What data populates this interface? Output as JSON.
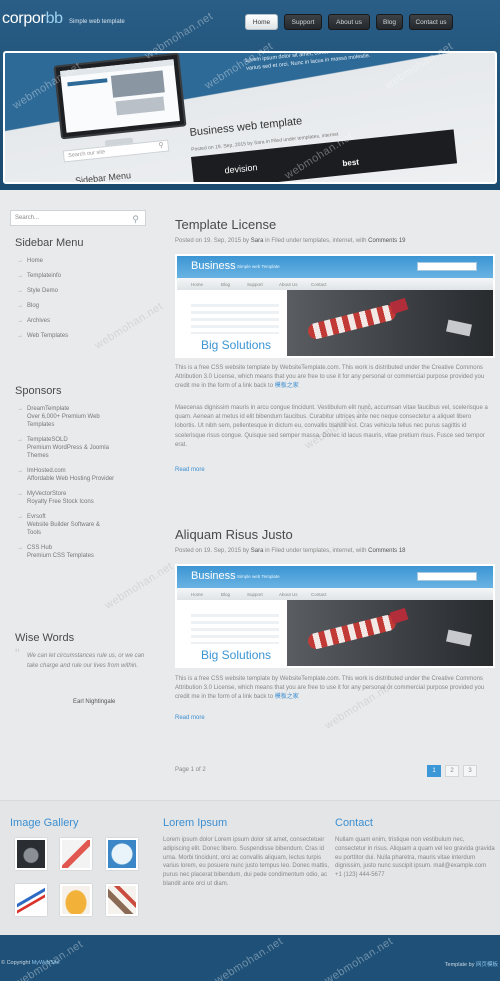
{
  "header": {
    "logo_a": "corpor",
    "logo_b": "bb",
    "tagline": "Simple web template",
    "nav": [
      "Home",
      "Support",
      "About us",
      "Blog",
      "Contact us"
    ],
    "active_nav": "Home"
  },
  "slider": {
    "text": "Lorem ipsum dolor sit amet, consectetur adipiscing elit simple aliquam et adipiscing tincidunt auctor varius sed et orci. Nunc in lacus in massa molestie.",
    "search_placeholder": "Search our site",
    "sidebar_label": "Sidebar Menu",
    "heading": "Business web template",
    "meta": "Posted on 19. Sep, 2015 by Sara in Filed under templates, internet",
    "banner_a": "devision",
    "banner_b": "best"
  },
  "sidebar": {
    "search_placeholder": "Search...",
    "menu_title": "Sidebar Menu",
    "menu_items": [
      "Home",
      "Templateinfo",
      "Style Demo",
      "Blog",
      "Archives",
      "Web Templates"
    ],
    "sponsors_title": "Sponsors",
    "sponsors": [
      {
        "name": "DreamTemplate",
        "desc": "Over 6,000+ Premium Web Templates"
      },
      {
        "name": "TemplateSOLD",
        "desc": "Premium WordPress & Joomla Themes"
      },
      {
        "name": "ImHosted.com",
        "desc": "Affordable Web Hosting Provider"
      },
      {
        "name": "MyVectorStore",
        "desc": "Royalty Free Stock Icons"
      },
      {
        "name": "Evrsoft",
        "desc": "Website Builder Software & Tools"
      },
      {
        "name": "CSS Hub",
        "desc": "Premium CSS Templates"
      }
    ],
    "words_title": "Wise Words",
    "quote": "We can let circumstances rule us, or we can take charge and rule our lives from within.",
    "quote_author": "Earl Nightingale"
  },
  "posts": [
    {
      "title": "Template License",
      "meta_prefix": "Posted on 19. Sep, 2015 by ",
      "author": "Sara",
      "meta_mid": " in Filed under templates, internet, with ",
      "comments": "Comments 19",
      "image_brand": "Business",
      "image_tag": "Simple web Template",
      "image_menu": [
        "Home",
        "Blog",
        "Support",
        "About Us",
        "Contact"
      ],
      "image_big": "Big Solutions",
      "body1": "This is a free CSS website template by WebsiteTemplate.com. This work is distributed under the Creative Commons Attribution 3.0 License, which means that you are free to use it for any personal or commercial purpose provided you credit me in the form of a link back to ",
      "body1_link": "模板之家",
      "body2": "Maecenas dignissim mauris in arcu congue tincidunt. Vestibulum elit nunc, accumsan vitae faucibus vel, scelerisque a quam. Aenean at metus id elit bibendum faucibus. Curabitur ultrices ante nec neque consectetur a aliquet libero lobortis. Ut nibh sem, pellentesque in dictum eu, convallis blandit est. Cras vehicula tellus nec purus sagittis id scelerisque risus congue. Quisque sed semper massa. Donec id lacus mauris, vitae pretium risus. Fusce sed tempor erat.",
      "read_more": "Read more"
    },
    {
      "title": "Aliquam Risus Justo",
      "meta_prefix": "Posted on 19. Sep, 2015 by ",
      "author": "Sara",
      "meta_mid": " in Filed under templates, internet, with ",
      "comments": "Comments 18",
      "image_brand": "Business",
      "image_tag": "Simple web Template",
      "image_menu": [
        "Home",
        "Blog",
        "Support",
        "About Us",
        "Contact"
      ],
      "image_big": "Big Solutions",
      "body1": "This is a free CSS website template by WebsiteTemplate.com. This work is distributed under the Creative Commons Attribution 3.0 License, which means that you are free to use it for any personal or commercial purpose provided you credit me in the form of a link back to ",
      "body1_link": "模板之家",
      "read_more": "Read more"
    }
  ],
  "pagination": {
    "label": "Page 1 of 2",
    "pages": [
      "1",
      "2",
      "3"
    ],
    "active": "1"
  },
  "bottom": {
    "gallery_title": "Image Gallery",
    "gallery_icons": [
      "camera-icon",
      "shoes-icon",
      "clock-icon",
      "chart-arrow-icon",
      "idea-icon",
      "tools-icon"
    ],
    "lorem_title": "Lorem Ipsum",
    "lorem_text": "Lorem ipsum dolor Lorem ipsum dolor sit amet, consectetuer adipiscing elit. Donec libero. Suspendisse bibendum. Cras id urna. Morbi tincidunt, orci ac convallis aliquam, lectus turpis varius lorem, eu posuere nunc justo tempus leo. Donec mattis, purus nec placerat bibendum, dui pede condimentum odio, ac blandit ante orci ut diam.",
    "contact_title": "Contact",
    "contact_text": "Nullam quam enim, tristique non vestibulum nec, consectetur in risus. Aliquam a quam vel leo gravida gravida eu porttitor dui. Nulla pharetra, mauris vitae interdum dignissim, justo nunc suscipit ipsum. mail@example.com",
    "contact_phone": "+1 (123) 444-5677"
  },
  "footer": {
    "copyright": "© Copyright ",
    "copyright_link": "MyWebSite",
    "credit_prefix": "Template by ",
    "credit_link": "网页模板"
  },
  "watermark": "webmohan.net",
  "colors": {
    "header": "#1f5076",
    "accent": "#3c8fd1",
    "page_bg": "#e9eaeb",
    "footer": "#1f5178"
  }
}
